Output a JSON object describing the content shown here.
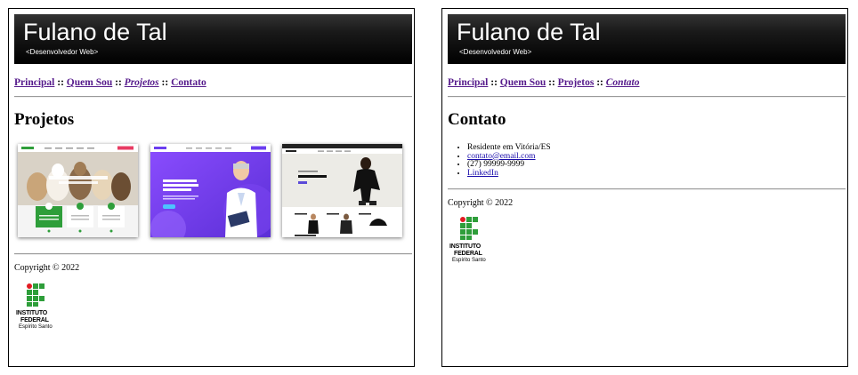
{
  "header": {
    "name": "Fulano de Tal",
    "subtitle": "<Desenvolvedor Web>"
  },
  "nav": {
    "home": "Principal",
    "about": "Quem Sou",
    "projects": "Projetos",
    "contact": "Contato",
    "separator": "::"
  },
  "projects_page": {
    "heading": "Projetos",
    "thumbnails": [
      {
        "icon": "pet-website-screenshot",
        "hero_text": "Dog Walking & Pet Care"
      },
      {
        "icon": "medical-website-screenshot",
        "hero_text": "Growing up your children with our most smart healthcare"
      },
      {
        "icon": "fashion-store-screenshot",
        "hero_text": "NEW ARRIVALS"
      }
    ]
  },
  "contact_page": {
    "heading": "Contato",
    "items": [
      "Residente em Vitória/ES",
      "contato@email.com",
      "(27) 99999-9999",
      "LinkedIn"
    ]
  },
  "footer": {
    "copyright": "Copyright © 2022",
    "logo_line1": "INSTITUTO",
    "logo_line2": "FEDERAL",
    "logo_line3": "Espírito Santo"
  },
  "colors": {
    "logo_red": "#e11b22",
    "logo_green": "#2e9e3a",
    "visited_link": "#551a8b",
    "link": "#1a0dab"
  }
}
